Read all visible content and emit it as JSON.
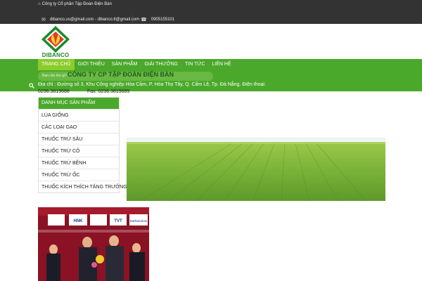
{
  "topbar": {
    "company": "Công ty Cổ phần Tập Đoàn Điện Bàn",
    "emails": "dibanco.us@gmail.com - dibanco.tt@gmail.com",
    "phone": "0905155101"
  },
  "logo": {
    "brand": "DIBANCO"
  },
  "nav": {
    "items": [
      "TRANG CHỦ",
      "GIỚI THIỆU",
      "SẢN PHẨM",
      "GIẢI THƯỞNG",
      "TIN TỨC",
      "LIÊN HỆ"
    ],
    "search_placeholder": "Bạn cần tìm gì?"
  },
  "company_info": {
    "name": "CÔNG TY CP TẬP ĐOÀN ĐIỆN BÀN",
    "address": "Địa chỉ : Đường số 3, Khu Công nghiệp Hòa Cầm, P. Hòa Thọ Tây, Q. Cẩm Lệ, Tp. Đà Nẵng. Điện thoại:",
    "phone": "0236.3819688",
    "fax": "Fax: 0236.3819689"
  },
  "categories": {
    "title": "DANH MỤC SẢN PHẨM",
    "items": [
      "LÚA GIỐNG",
      "CÁC LOẠI GẠO",
      "THUỐC TRỪ SÂU",
      "THUỐC TRỪ CỎ",
      "THUỐC TRỪ BỆNH",
      "THUỐC TRỪ ỐC",
      "THUỐC KÍCH THÍCH TĂNG TRƯỞNG"
    ]
  },
  "photo_sponsors": [
    "HNK",
    "TVT",
    "Bathwindow"
  ],
  "colors": {
    "nav_green": "#4aa82a",
    "active_green": "#8ccc2a",
    "topbar": "#333333"
  }
}
